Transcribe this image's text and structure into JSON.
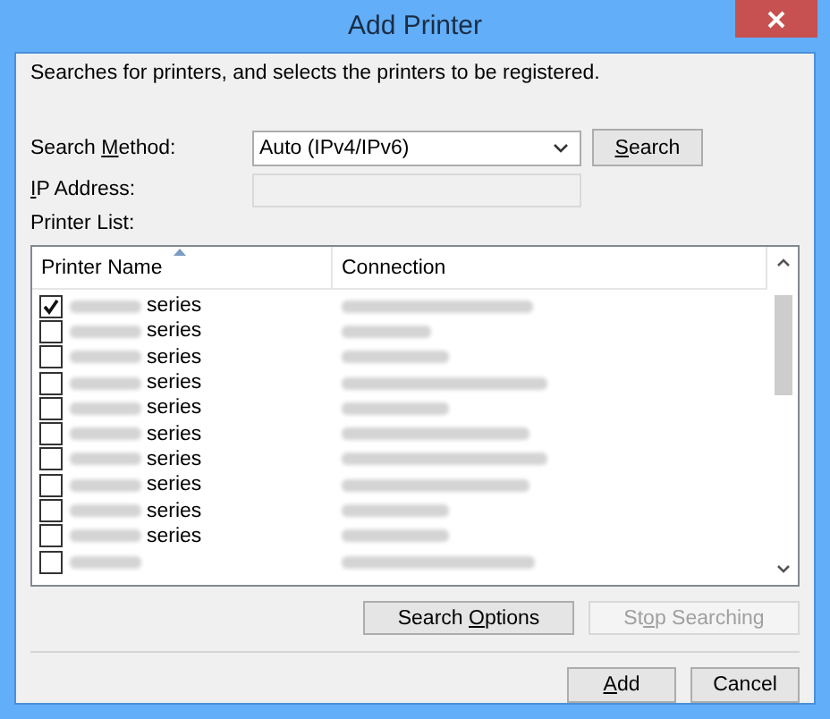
{
  "window": {
    "title": "Add Printer"
  },
  "description": "Searches for printers, and selects the printers to be registered.",
  "search_method": {
    "label_parts": [
      {
        "text": "Search "
      },
      {
        "text": "M",
        "access_key": true
      },
      {
        "text": "ethod:"
      }
    ],
    "value": "Auto (IPv4/IPv6)"
  },
  "search_button": {
    "label_parts": [
      {
        "text": "S",
        "access_key": true
      },
      {
        "text": "earch"
      }
    ]
  },
  "ip_address": {
    "label_parts": [
      {
        "text": "I",
        "access_key": true
      },
      {
        "text": "P Address:"
      }
    ],
    "disabled": true
  },
  "printer_list": {
    "label": "Printer List:",
    "columns": [
      {
        "label": "Printer Name",
        "sorted": true
      },
      {
        "label": "Connection",
        "sorted": false
      }
    ],
    "rows": [
      {
        "checked": true,
        "name": "series"
      },
      {
        "checked": false,
        "name": "series"
      },
      {
        "checked": false,
        "name": "series"
      },
      {
        "checked": false,
        "name": "series"
      },
      {
        "checked": false,
        "name": "series"
      },
      {
        "checked": false,
        "name": "series"
      },
      {
        "checked": false,
        "name": "series"
      },
      {
        "checked": false,
        "name": "series"
      },
      {
        "checked": false,
        "name": "series"
      },
      {
        "checked": false,
        "name": "series"
      },
      {
        "checked": false
      }
    ]
  },
  "buttons": [
    {
      "label_parts": [
        {
          "text": "Search "
        },
        {
          "text": "O",
          "access_key": true
        },
        {
          "text": "ptions"
        }
      ],
      "disabled": false
    },
    {
      "label_parts": [
        {
          "text": "St"
        },
        {
          "text": "o",
          "access_key": true
        },
        {
          "text": "p Searching"
        }
      ],
      "disabled": true
    }
  ],
  "footer_buttons": [
    {
      "label_parts": [
        {
          "text": "A",
          "access_key": true
        },
        {
          "text": "dd"
        }
      ]
    },
    {
      "label_parts": [
        {
          "text": "Cancel"
        }
      ]
    }
  ]
}
